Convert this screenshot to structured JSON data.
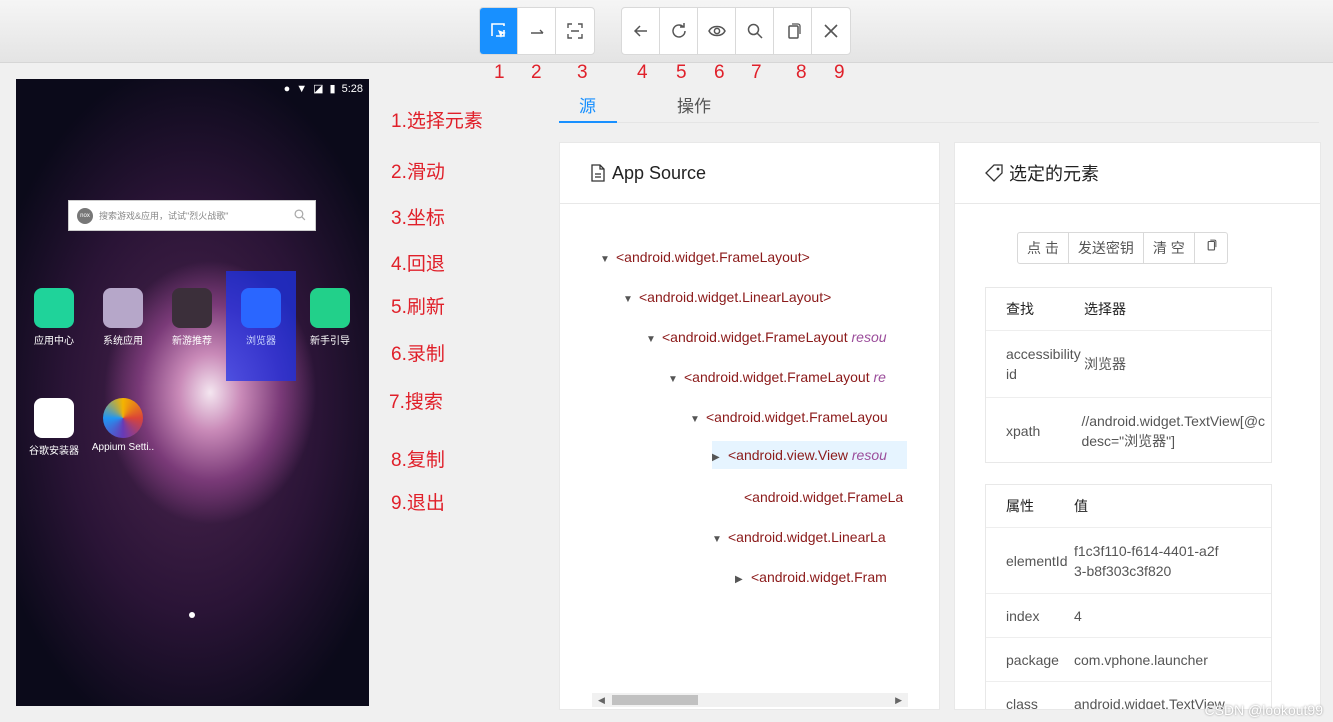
{
  "toolbar": {
    "group1": [
      {
        "name": "select-element",
        "icon": "select-cursor-icon",
        "active": true
      },
      {
        "name": "swipe",
        "icon": "swipe-arrow-icon"
      },
      {
        "name": "tap-coordinates",
        "icon": "crosshair-frame-icon"
      }
    ],
    "group2": [
      {
        "name": "back",
        "icon": "back-arrow-icon"
      },
      {
        "name": "refresh",
        "icon": "refresh-icon"
      },
      {
        "name": "record",
        "icon": "eye-icon"
      },
      {
        "name": "search",
        "icon": "search-icon"
      },
      {
        "name": "copy",
        "icon": "copy-icon"
      },
      {
        "name": "quit",
        "icon": "close-icon"
      }
    ],
    "numbers": [
      "1",
      "2",
      "3",
      "4",
      "5",
      "6",
      "7",
      "8",
      "9"
    ]
  },
  "legend": [
    "1.选择元素",
    "2.滑动",
    "3.坐标",
    "4.回退",
    "5.刷新",
    "6.录制",
    "7.搜索",
    "8.复制",
    "9.退出"
  ],
  "phone": {
    "time": "5:28",
    "search_placeholder": "搜索游戏&应用，试试\"烈火战歌\"",
    "apps": [
      "应用中心",
      "系统应用",
      "新游推荐",
      "浏览器",
      "新手引导",
      "谷歌安装器",
      "Appium Setti.."
    ]
  },
  "tabs": {
    "source": "源",
    "actions": "操作"
  },
  "source_card": {
    "title": "App Source",
    "tree": [
      {
        "text": "<android.widget.FrameLayout>",
        "attr": ""
      },
      {
        "text": "<android.widget.LinearLayout>",
        "attr": ""
      },
      {
        "text": "<android.widget.FrameLayout ",
        "attr": "resou"
      },
      {
        "text": "<android.widget.FrameLayout ",
        "attr": "re"
      },
      {
        "text": "<android.widget.FrameLayou",
        "attr": ""
      },
      {
        "text": "<android.view.View ",
        "attr": "resou"
      },
      {
        "text": "<android.widget.FrameLa",
        "attr": ""
      },
      {
        "text": "<android.widget.LinearLa",
        "attr": ""
      },
      {
        "text": "<android.widget.Fram",
        "attr": ""
      }
    ]
  },
  "selected_card": {
    "title": "选定的元素",
    "actions": [
      "点 击",
      "发送密钥",
      "清 空"
    ],
    "find_table": {
      "headers": [
        "查找",
        "选择器"
      ],
      "rows": [
        {
          "k": "accessibility id",
          "v": "浏览器"
        },
        {
          "k": "xpath",
          "v": "//android.widget.TextView[@c desc=\"浏览器\"]"
        }
      ]
    },
    "attr_table": {
      "headers": [
        "属性",
        "值"
      ],
      "rows": [
        {
          "k": "elementId",
          "v": "f1c3f110-f614-4401-a2f3-b8f303c3f820"
        },
        {
          "k": "index",
          "v": "4"
        },
        {
          "k": "package",
          "v": "com.vphone.launcher"
        },
        {
          "k": "class",
          "v": "android.widget.TextView"
        }
      ]
    }
  },
  "watermark": "CSDN @lookout99"
}
